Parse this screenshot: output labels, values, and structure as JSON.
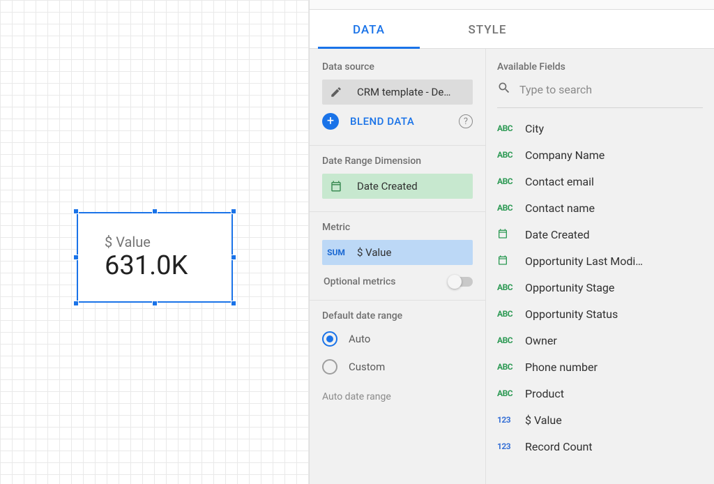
{
  "scorecard": {
    "label": "$ Value",
    "value": "631.0K"
  },
  "tabs": {
    "data": "DATA",
    "style": "STYLE"
  },
  "dataPanel": {
    "dataSourceTitle": "Data source",
    "dataSourceName": "CRM template - De…",
    "blendLabel": "BLEND DATA",
    "dateRangeTitle": "Date Range Dimension",
    "dateDimension": "Date Created",
    "metricTitle": "Metric",
    "metricAgg": "SUM",
    "metricName": "$ Value",
    "optionalMetricsTitle": "Optional metrics",
    "defaultRangeTitle": "Default date range",
    "autoLabel": "Auto",
    "customLabel": "Custom",
    "autoDateLabel": "Auto date range"
  },
  "fieldsPanel": {
    "title": "Available Fields",
    "searchPlaceholder": "Type to search",
    "fields": [
      {
        "type": "abc",
        "label": "City"
      },
      {
        "type": "abc",
        "label": "Company Name"
      },
      {
        "type": "abc",
        "label": "Contact email"
      },
      {
        "type": "abc",
        "label": "Contact name"
      },
      {
        "type": "date",
        "label": "Date Created"
      },
      {
        "type": "date",
        "label": "Opportunity Last Modi…"
      },
      {
        "type": "abc",
        "label": "Opportunity Stage"
      },
      {
        "type": "abc",
        "label": "Opportunity Status"
      },
      {
        "type": "abc",
        "label": "Owner"
      },
      {
        "type": "abc",
        "label": "Phone number"
      },
      {
        "type": "abc",
        "label": "Product"
      },
      {
        "type": "num",
        "label": "$ Value"
      },
      {
        "type": "num",
        "label": "Record Count"
      }
    ]
  }
}
